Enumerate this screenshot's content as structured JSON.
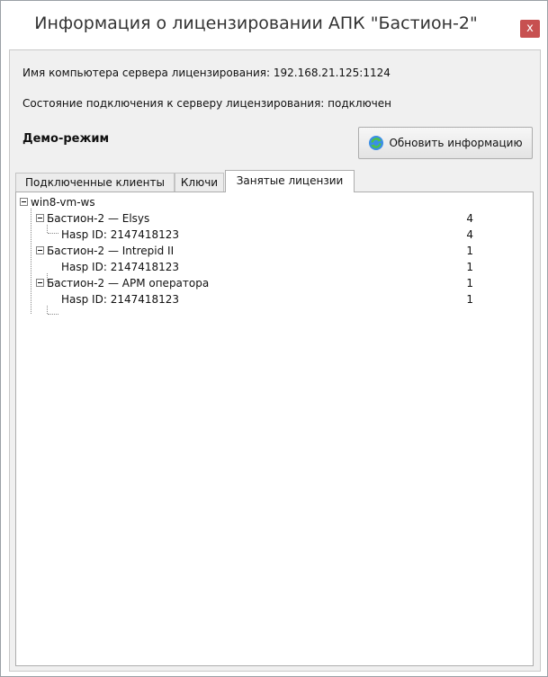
{
  "window": {
    "title": "Информация о лицензировании АПК \"Бастион-2\"",
    "close_glyph": "x",
    "close_color": "#c75050"
  },
  "info": {
    "server_line": "Имя компьютера сервера лицензирования: 192.168.21.125:1124",
    "status_line": "Состояние подключения к серверу лицензирования: подключен",
    "mode": "Демо-режим"
  },
  "refresh_button": {
    "label": "Обновить информацию",
    "icon": "refresh-icon"
  },
  "tabs": [
    {
      "label": "Подключенные клиенты",
      "active": false
    },
    {
      "label": "Ключи",
      "active": false
    },
    {
      "label": "Занятые лицензии",
      "active": true
    }
  ],
  "tree": {
    "root": "win8-vm-ws",
    "nodes": [
      {
        "label": "Бастион-2 — Elsys",
        "count": "4",
        "child": {
          "label": "Hasp ID: 2147418123",
          "count": "4"
        }
      },
      {
        "label": "Бастион-2 — Intrepid II",
        "count": "1",
        "child": {
          "label": "Hasp ID: 2147418123",
          "count": "1"
        }
      },
      {
        "label": "Бастион-2 — АРМ оператора",
        "count": "1",
        "child": {
          "label": "Hasp ID: 2147418123",
          "count": "1"
        }
      }
    ]
  }
}
